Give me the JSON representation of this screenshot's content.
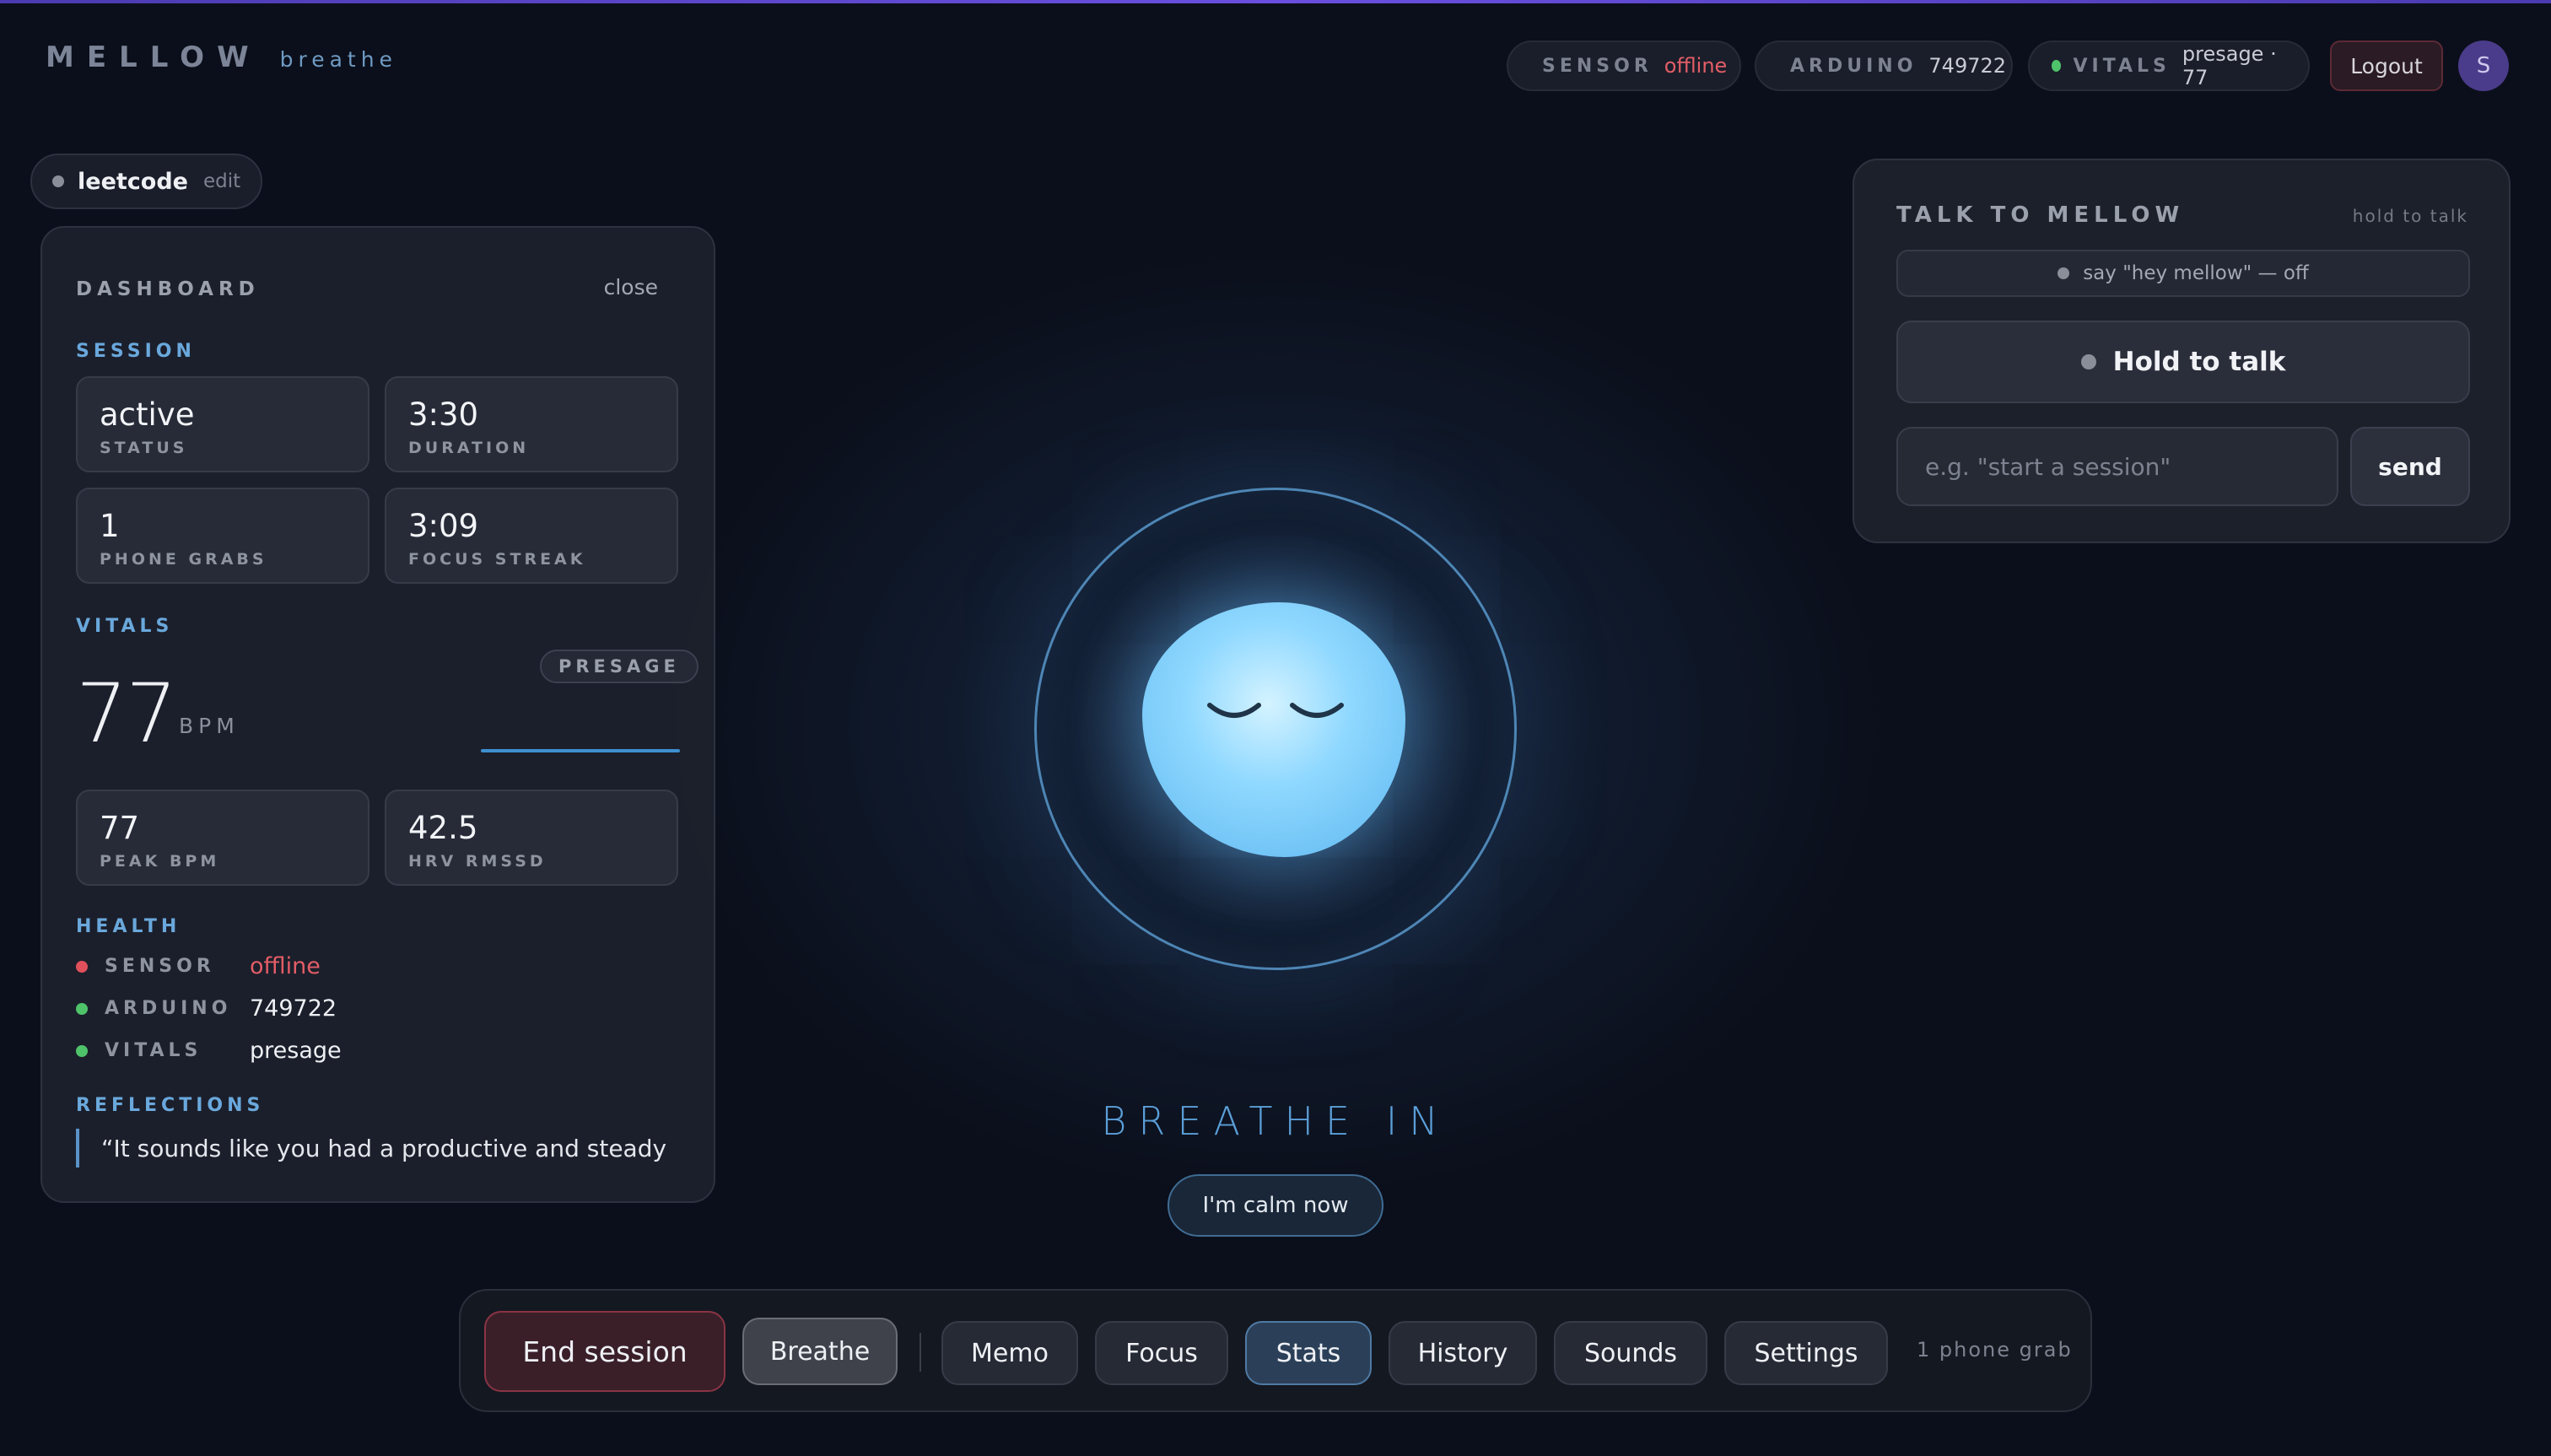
{
  "app": {
    "name": "MELLOW",
    "subtitle": "breathe"
  },
  "status": {
    "sensor": {
      "label": "SENSOR",
      "value": "offline",
      "color": "#e0505a"
    },
    "arduino": {
      "label": "ARDUINO",
      "value": "749722",
      "color": "#4fc36a"
    },
    "vitals": {
      "label": "VITALS",
      "value": "presage · 77",
      "color": "#4fc36a"
    }
  },
  "header": {
    "logout_label": "Logout",
    "avatar_initial": "S"
  },
  "task": {
    "name": "leetcode",
    "edit_label": "edit"
  },
  "dashboard": {
    "title": "DASHBOARD",
    "close_label": "close",
    "session_heading": "SESSION",
    "session": [
      {
        "value": "active",
        "label": "STATUS"
      },
      {
        "value": "3:30",
        "label": "DURATION"
      },
      {
        "value": "1",
        "label": "PHONE GRABS"
      },
      {
        "value": "3:09",
        "label": "FOCUS STREAK"
      }
    ],
    "vitals_heading": "VITALS",
    "bpm": "77",
    "bpm_unit": "BPM",
    "vitals_source": "PRESAGE",
    "vitals_cards": [
      {
        "value": "77",
        "label": "PEAK BPM"
      },
      {
        "value": "42.5",
        "label": "HRV RMSSD"
      }
    ],
    "health_heading": "HEALTH",
    "health": [
      {
        "label": "SENSOR",
        "value": "offline",
        "state": "red"
      },
      {
        "label": "ARDUINO",
        "value": "749722",
        "state": "green"
      },
      {
        "label": "VITALS",
        "value": "presage",
        "state": "green"
      }
    ],
    "reflections_heading": "REFLECTIONS",
    "reflection": "“It sounds like you had a productive and steady"
  },
  "center": {
    "prompt": "BREATHE IN",
    "calm_label": "I'm calm now"
  },
  "talk": {
    "title": "TALK TO MELLOW",
    "hint": "hold to talk",
    "wake_word": "say \"hey mellow\" — off",
    "hold_label": "Hold to talk",
    "input_placeholder": "e.g. \"start a session\"",
    "send_label": "send"
  },
  "toolbar": {
    "end_label": "End session",
    "breathe_label": "Breathe",
    "memo_label": "Memo",
    "focus_label": "Focus",
    "stats_label": "Stats",
    "history_label": "History",
    "sounds_label": "Sounds",
    "settings_label": "Settings",
    "grab_count": "1 phone grab"
  },
  "colors": {
    "accent": "#5b9fd8",
    "danger": "#e35d66",
    "ok": "#4fc36a",
    "bg": "#0b0f1b"
  }
}
